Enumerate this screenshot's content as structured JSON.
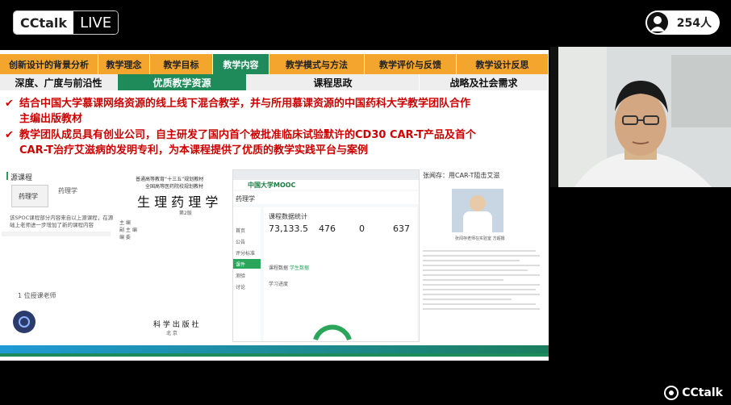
{
  "header": {
    "brand": "CCtalk",
    "live_label": "LIVE",
    "viewer_count": "254人"
  },
  "slide": {
    "nav_top": [
      {
        "label": "创新设计的背景分析",
        "active": false
      },
      {
        "label": "教学理念",
        "active": false
      },
      {
        "label": "教学目标",
        "active": false
      },
      {
        "label": "教学内容",
        "active": true
      },
      {
        "label": "教学模式与方法",
        "active": false
      },
      {
        "label": "教学评价与反馈",
        "active": false
      },
      {
        "label": "教学设计反思",
        "active": false
      }
    ],
    "nav_sub": [
      {
        "label": "深度、广度与前沿性",
        "active": false
      },
      {
        "label": "优质教学资源",
        "active": true
      },
      {
        "label": "课程思政",
        "active": false
      },
      {
        "label": "战略及社会需求",
        "active": false
      }
    ],
    "bullets": [
      {
        "line1": "结合中国大学慕课网络资源的线上线下混合教学，并与所用慕课资源的中国药科大学教学团队合作",
        "line2": "主编出版教材"
      },
      {
        "line1": "教学团队成员具有创业公司，自主研发了国内首个被批准临床试验默许的CD30  CAR-T产品及首个",
        "line2": "CAR-T治疗艾滋病的发明专利，为本课程提供了优质的教学实践平台与案例"
      }
    ],
    "course_panel": {
      "header": "源课程",
      "course_name": "药理学",
      "desc_line1": "该SPOC课程部分内容来自以上源课程，在源课",
      "desc_line2": "础上老师进一步增加了新的课程内容",
      "teacher_header": "1 位授课老师"
    },
    "book": {
      "line1": "普通高等教育“十三五”规划教材",
      "line2": "全国高等医药院校规划教材",
      "title": "生 理 药 理 学",
      "edition": "第2版",
      "author_label1": "主  编",
      "author_label2": "副 主 编",
      "author_label3": "编  委",
      "publisher": "科 学 出 版 社",
      "city": "北 京"
    },
    "mooc": {
      "logo": "中国大学MOOC",
      "course": "药理学",
      "section_title": "课程数据统计",
      "stats": [
        "73,133.5",
        "476",
        "0",
        "637"
      ],
      "tab1": "课程数据",
      "tab2": "学生数据",
      "sub_title": "学习进度",
      "menu": [
        "首页",
        "公告",
        "评分标准",
        "课件",
        "测验",
        "讨论"
      ]
    },
    "article": {
      "title": "张闻存：用CAR-T阻击艾滋",
      "caption": "张闻存老师在实验室 方超摄",
      "subhead": "这一有趣规定是CAR-T是啥"
    }
  },
  "footer": {
    "brand": "CCtalk"
  },
  "colors": {
    "nav_orange": "#f4a52e",
    "nav_active_green": "#1f8a5a",
    "bullet_red": "#cc0000",
    "stripe_blue": "#1f9ad6"
  }
}
